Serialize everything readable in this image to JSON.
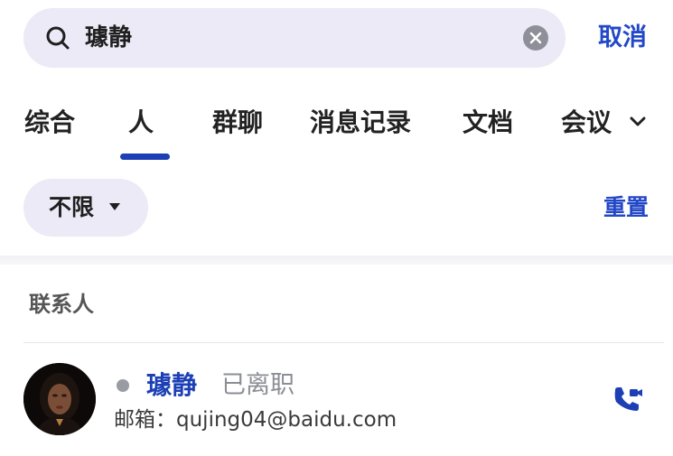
{
  "search": {
    "value": "璩静"
  },
  "header": {
    "cancel_label": "取消"
  },
  "tabs": [
    {
      "label": "综合",
      "active": false
    },
    {
      "label": "人",
      "active": true
    },
    {
      "label": "群聊",
      "active": false
    },
    {
      "label": "消息记录",
      "active": false
    },
    {
      "label": "文档",
      "active": false
    },
    {
      "label": "会议",
      "active": false
    }
  ],
  "filter": {
    "selected": "不限",
    "reset_label": "重置"
  },
  "section": {
    "title": "联系人"
  },
  "contacts": [
    {
      "name": "璩静",
      "status": "已离职",
      "email": "邮箱：qujing04@baidu.com",
      "presence": "offline"
    }
  ],
  "colors": {
    "accent": "#1c3fb5",
    "chip_bg": "#ebeaf6",
    "muted_text": "#8c8e96"
  },
  "icons": {
    "search": "search-icon",
    "clear": "clear-icon",
    "tab_more": "chevron-down-icon",
    "filter_caret": "caret-down-icon",
    "call": "video-call-icon"
  }
}
